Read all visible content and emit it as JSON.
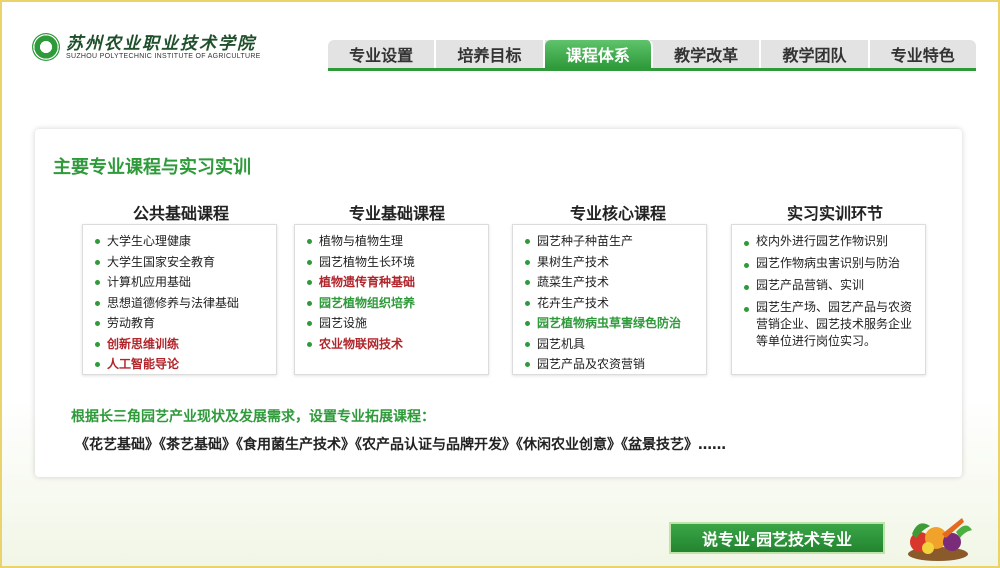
{
  "header": {
    "school_cn": "苏州农业职业技术学院",
    "school_en": "SUZHOU POLYTECHNIC INSTITUTE OF AGRICULTURE",
    "tabs": [
      {
        "label": "专业设置",
        "active": false
      },
      {
        "label": "培养目标",
        "active": false
      },
      {
        "label": "课程体系",
        "active": true
      },
      {
        "label": "教学改革",
        "active": false
      },
      {
        "label": "教学团队",
        "active": false
      },
      {
        "label": "专业特色",
        "active": false
      }
    ]
  },
  "main": {
    "title": "主要专业课程与实习实训",
    "columns": [
      {
        "heading": "公共基础课程",
        "items": [
          {
            "text": "大学生心理健康",
            "style": "normal"
          },
          {
            "text": "大学生国家安全教育",
            "style": "normal"
          },
          {
            "text": "计算机应用基础",
            "style": "normal"
          },
          {
            "text": "思想道德修养与法律基础",
            "style": "normal"
          },
          {
            "text": "劳动教育",
            "style": "normal"
          },
          {
            "text": "创新思维训练",
            "style": "red"
          },
          {
            "text": "人工智能导论",
            "style": "red"
          }
        ]
      },
      {
        "heading": "专业基础课程",
        "items": [
          {
            "text": "植物与植物生理",
            "style": "normal"
          },
          {
            "text": "园艺植物生长环境",
            "style": "normal"
          },
          {
            "text": "植物遗传育种基础",
            "style": "red"
          },
          {
            "text": "园艺植物组织培养",
            "style": "green"
          },
          {
            "text": "园艺设施",
            "style": "normal"
          },
          {
            "text": "农业物联网技术",
            "style": "red"
          }
        ]
      },
      {
        "heading": "专业核心课程",
        "items": [
          {
            "text": "园艺种子种苗生产",
            "style": "normal"
          },
          {
            "text": "果树生产技术",
            "style": "normal"
          },
          {
            "text": "蔬菜生产技术",
            "style": "normal"
          },
          {
            "text": "花卉生产技术",
            "style": "normal"
          },
          {
            "text": "园艺植物病虫草害绿色防治",
            "style": "green"
          },
          {
            "text": "园艺机具",
            "style": "normal"
          },
          {
            "text": "园艺产品及农资营销",
            "style": "normal"
          }
        ]
      },
      {
        "heading": "实习实训环节",
        "items": [
          {
            "text": "校内外进行园艺作物识别",
            "style": "normal"
          },
          {
            "text": "园艺作物病虫害识别与防治",
            "style": "normal"
          },
          {
            "text": "园艺产品营销、实训",
            "style": "normal"
          },
          {
            "text": "园艺生产场、园艺产品与农资营销企业、园艺技术服务企业等单位进行岗位实习。",
            "style": "normal"
          }
        ]
      }
    ],
    "extension_title": "根据长三角园艺产业现状及发展需求，设置专业拓展课程：",
    "extension_courses": "《花艺基础》《茶艺基础》《食用菌生产技术》《农产品认证与品牌开发》《休闲农业创意》《盆景技艺》……"
  },
  "footer": {
    "badge": "说专业·园艺技术专业"
  },
  "colors": {
    "accent_green": "#2e9a3a",
    "highlight_red": "#b1262c",
    "border_yellow": "#e9d36a"
  }
}
